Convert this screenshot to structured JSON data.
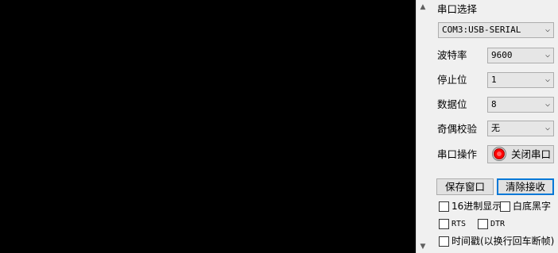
{
  "terminal": {
    "content": ""
  },
  "panel": {
    "port_label": "串口选择",
    "port_value": "COM3:USB-SERIAL",
    "baud_label": "波特率",
    "baud_value": "9600",
    "stop_label": "停止位",
    "stop_value": "1",
    "data_label": "数据位",
    "data_value": "8",
    "parity_label": "奇偶校验",
    "parity_value": "无",
    "op_label": "串口操作",
    "op_button": "关闭串口",
    "save_button": "保存窗口",
    "clear_button": "清除接收",
    "hex_label": "16进制显示",
    "white_label": "白底黑字",
    "rts_label": "RTS",
    "dtr_label": "DTR",
    "timestamp_label": "时间戳(以换行回车断帧)"
  },
  "colors": {
    "terminal_bg": "#000000",
    "led": "#ff0000",
    "focus": "#0078d7"
  }
}
